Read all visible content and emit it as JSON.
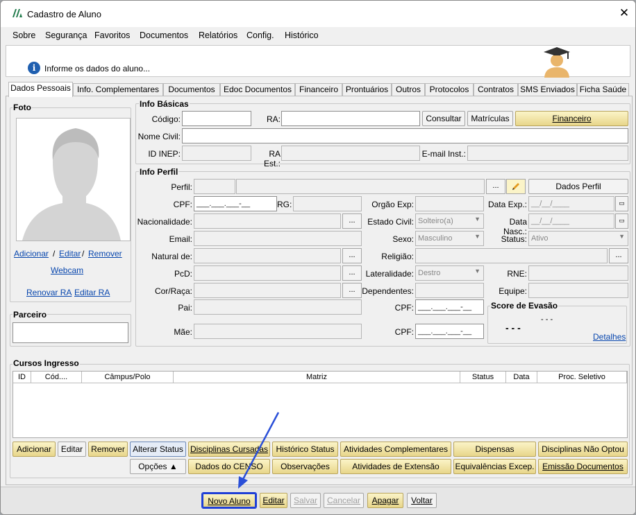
{
  "window": {
    "title": "Cadastro de Aluno",
    "close": "✕"
  },
  "menu": [
    "Sobre",
    "Segurança",
    "Favoritos",
    "Documentos",
    "Relatórios",
    "Config.",
    "Histórico"
  ],
  "banner": {
    "message": "Informe os dados do aluno...",
    "info_glyph": "i"
  },
  "tabs": [
    "Dados Pessoais",
    "Info. Complementares",
    "Documentos",
    "Edoc Documentos",
    "Financeiro",
    "Prontuários",
    "Outros",
    "Protocolos",
    "Contratos",
    "SMS Enviados",
    "Ficha Saúde"
  ],
  "foto": {
    "title": "Foto",
    "add": "Adicionar",
    "sep1": "/",
    "edit": "Editar",
    "sep2": "/",
    "remove": "Remover",
    "webcam": "Webcam",
    "renew_ra": "Renovar RA",
    "edit_ra": "Editar RA"
  },
  "parceiro": {
    "title": "Parceiro"
  },
  "info_basicas": {
    "title": "Info Básicas",
    "codigo": "Código:",
    "ra": "RA:",
    "consultar": "Consultar",
    "matriculas": "Matrículas",
    "financeiro": "Financeiro",
    "nome_civil": "Nome Civil:",
    "id_inep": "ID INEP:",
    "ra_est": "RA Est.:",
    "email_inst": "E-mail Inst.:"
  },
  "info_perfil": {
    "title": "Info Perfil",
    "perfil": "Perfil:",
    "ellipsis": "...",
    "dados_perfil": "Dados Perfil",
    "cpf": "CPF:",
    "cpf_mask": "___.___.___-__",
    "rg": "RG:",
    "orgao_exp": "Orgão Exp:",
    "data_exp": "Data Exp.:",
    "date_mask": "__/__/____",
    "nacionalidade": "Nacionalidade:",
    "estado_civil": "Estado Civil:",
    "estado_civil_value": "Solteiro(a)",
    "data_nasc": "Data Nasc.:",
    "email": "Email:",
    "sexo": "Sexo:",
    "sexo_value": "Masculino",
    "status": "Status:",
    "status_value": "Ativo",
    "natural_de": "Natural de:",
    "religiao": "Religião:",
    "pcd": "PcD:",
    "lateralidade": "Lateralidade:",
    "lateralidade_value": "Destro",
    "rne": "RNE:",
    "cor_raca": "Cor/Raça:",
    "dependentes": "Dependentes:",
    "equipe": "Equipe:",
    "pai": "Pai:",
    "cpf_pai": "CPF:",
    "mae": "Mãe:",
    "cpf_mae": "CPF:",
    "score": {
      "title": "Score de Evasão",
      "value_top": "- - -",
      "value_big": "- - -",
      "details": "Detalhes"
    }
  },
  "cursos": {
    "title": "Cursos Ingresso",
    "columns": [
      "ID",
      "Cód....",
      "Câmpus/Polo",
      "Matriz",
      "Status",
      "Data",
      "Proc. Seletivo"
    ],
    "row1": [
      "Adicionar",
      "Editar",
      "Remover",
      "Alterar Status",
      "Disciplinas Cursadas",
      "Histórico Status",
      "Atividades Complementares",
      "Dispensas",
      "Disciplinas Não Optou"
    ],
    "row2": [
      "Opções ▲",
      "Dados do CENSO",
      "Observações",
      "Atividades de Extensão",
      "Equivalências Excep.",
      "Emissão Documentos"
    ]
  },
  "footer": {
    "buttons": [
      "Novo Aluno",
      "Editar",
      "Salvar",
      "Cancelar",
      "Apagar",
      "Voltar"
    ]
  },
  "colors": {
    "highlight": "#1f3fd6",
    "gold_button": "#e8d68a",
    "link": "#0645ad",
    "annotation_arrow": "#2a4fd8"
  }
}
